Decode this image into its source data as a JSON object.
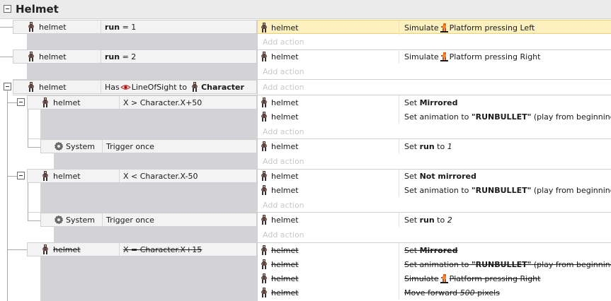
{
  "group": {
    "title": "Helmet"
  },
  "objects": {
    "helmet": "helmet",
    "system": "System",
    "character": "Character",
    "add_action": "Add action"
  },
  "events": [
    {
      "condition": {
        "object": "helmet",
        "var": "run",
        "op": "= 1"
      },
      "actions": [
        {
          "object": "helmet",
          "pre": "Simulate",
          "post": "Platform pressing Left"
        }
      ]
    },
    {
      "condition": {
        "object": "helmet",
        "var": "run",
        "op": "= 2"
      },
      "actions": [
        {
          "object": "helmet",
          "pre": "Simulate",
          "post": "Platform pressing Right"
        }
      ]
    },
    {
      "condition": {
        "object": "helmet",
        "pre": "Has",
        "behavior": "LineOfSight to",
        "target": "Character"
      }
    },
    {
      "condition": {
        "object": "helmet",
        "text": "X > Character.X+50"
      },
      "actions": [
        {
          "object": "helmet",
          "pre": "Set",
          "bold": "Mirrored"
        },
        {
          "object": "helmet",
          "pre": "Set animation to",
          "bold": "\"RUNBULLET\"",
          "post": "(play from beginning)"
        }
      ]
    },
    {
      "condition": {
        "object": "System",
        "text": "Trigger once"
      },
      "actions": [
        {
          "object": "helmet",
          "pre": "Set",
          "bold": "run",
          "mid": "to",
          "italic": "1"
        }
      ]
    },
    {
      "condition": {
        "object": "helmet",
        "text": "X < Character.X-50"
      },
      "actions": [
        {
          "object": "helmet",
          "pre": "Set",
          "bold": "Not mirrored"
        },
        {
          "object": "helmet",
          "pre": "Set animation to",
          "bold": "\"RUNBULLET\"",
          "post": "(play from beginning)"
        }
      ]
    },
    {
      "condition": {
        "object": "System",
        "text": "Trigger once"
      },
      "actions": [
        {
          "object": "helmet",
          "pre": "Set",
          "bold": "run",
          "mid": "to",
          "italic": "2"
        }
      ]
    },
    {
      "condition": {
        "object": "helmet",
        "text": "X = Character.X+15"
      },
      "actions": [
        {
          "object": "helmet",
          "pre": "Set",
          "bold": "Mirrored"
        },
        {
          "object": "helmet",
          "pre": "Set animation to",
          "bold": "\"RUNBULLET\"",
          "post": "(play from beginning)"
        },
        {
          "object": "helmet",
          "pre": "Simulate",
          "post": "Platform pressing Right"
        },
        {
          "object": "helmet",
          "pre": "Move forward",
          "italic": "500",
          "post": "pixels"
        }
      ]
    }
  ],
  "colors": {
    "highlight": "#fdf1c0",
    "condition_bg": "#f3f3f3",
    "sub_area": "#d3d3d7",
    "add_action": "#c8c8c8"
  }
}
